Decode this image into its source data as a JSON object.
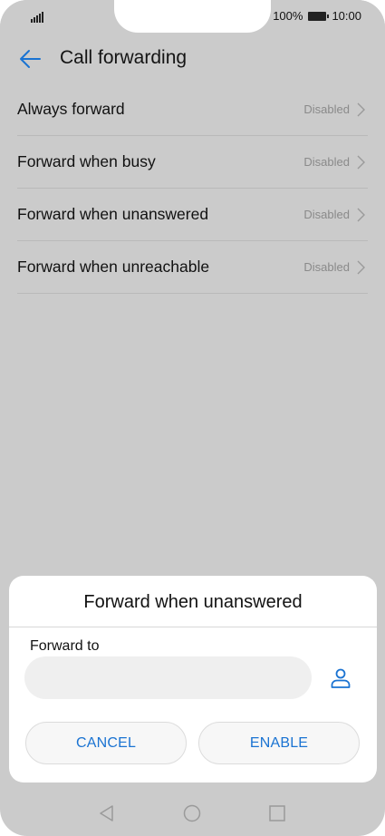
{
  "status_bar": {
    "battery_percent": "100%",
    "time": "10:00",
    "icons": [
      "signal-icon",
      "battery-icon"
    ]
  },
  "header": {
    "title": "Call forwarding",
    "back_icon": "arrow-left-icon"
  },
  "forwarding_options": [
    {
      "label": "Always forward",
      "status": "Disabled"
    },
    {
      "label": "Forward when busy",
      "status": "Disabled"
    },
    {
      "label": "Forward when unanswered",
      "status": "Disabled"
    },
    {
      "label": "Forward when unreachable",
      "status": "Disabled"
    }
  ],
  "dialog": {
    "title": "Forward when unanswered",
    "field_label": "Forward to",
    "field_value": "",
    "contact_icon": "person-icon",
    "cancel_label": "CANCEL",
    "enable_label": "ENABLE"
  },
  "nav_bar": {
    "icons": [
      "nav-back-icon",
      "nav-home-icon",
      "nav-recent-icon"
    ]
  },
  "colors": {
    "accent": "#1a73d2",
    "overlay_background": "#cbcbcb",
    "dialog_background": "#ffffff"
  }
}
